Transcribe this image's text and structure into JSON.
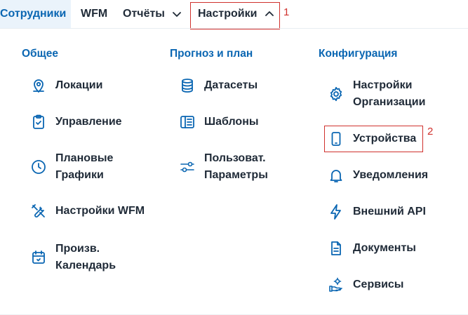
{
  "topnav": {
    "employees": "Сотрудники",
    "wfm": "WFM",
    "reports": "Отчёты",
    "settings": "Настройки",
    "marker1": "1"
  },
  "menu": {
    "general": {
      "title": "Общее",
      "items": [
        {
          "label": "Локации",
          "icon": "map-pin-icon"
        },
        {
          "label": "Управление",
          "icon": "clipboard-check-icon"
        },
        {
          "label": "Плановые\nГрафики",
          "icon": "clock-icon"
        },
        {
          "label": "Настройки WFM",
          "icon": "tools-icon"
        },
        {
          "label": "Произв.\nКалендарь",
          "icon": "calendar-check-icon"
        }
      ]
    },
    "forecast": {
      "title": "Прогноз и план",
      "items": [
        {
          "label": "Датасеты",
          "icon": "database-icon"
        },
        {
          "label": "Шаблоны",
          "icon": "template-icon"
        },
        {
          "label": "Пользоват.\nПараметры",
          "icon": "sliders-icon"
        }
      ]
    },
    "config": {
      "title": "Конфигурация",
      "items": [
        {
          "label": "Настройки\nОрганизации",
          "icon": "gear-icon"
        },
        {
          "label": "Устройства",
          "icon": "smartphone-icon"
        },
        {
          "label": "Уведомления",
          "icon": "bell-icon"
        },
        {
          "label": "Внешний API",
          "icon": "lightning-icon"
        },
        {
          "label": "Документы",
          "icon": "document-icon"
        },
        {
          "label": "Сервисы",
          "icon": "services-icon"
        }
      ],
      "marker2": "2"
    }
  },
  "colors": {
    "accent": "#0a66b2",
    "text": "#1f2a37",
    "highlight_box": "#d0312d",
    "active_tab_bg": "#eaf3fb"
  }
}
